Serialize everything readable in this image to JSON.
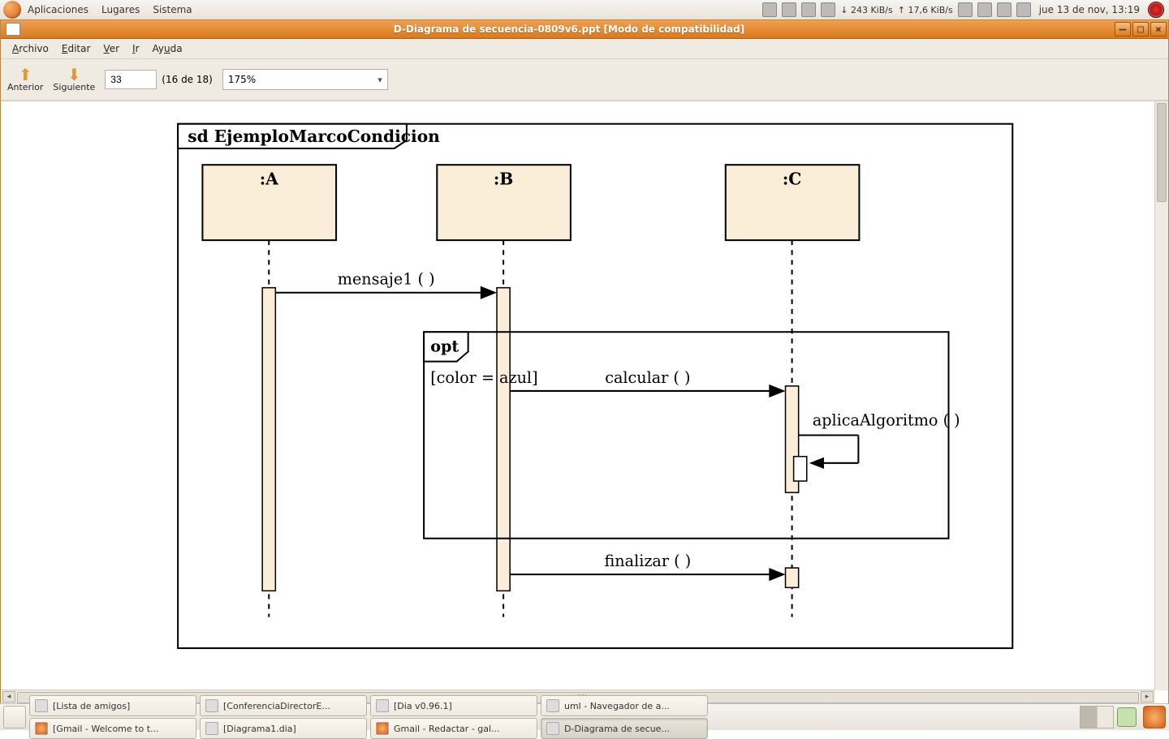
{
  "system": {
    "menus": {
      "apps": "Aplicaciones",
      "places": "Lugares",
      "system": "Sistema"
    },
    "net_down": "↓ 243 KiB/s",
    "net_up": "↑ 17,6 KiB/s",
    "clock": "jue 13 de nov, 13:19"
  },
  "window": {
    "title": "D-Diagrama de secuencia-0809v6.ppt [Modo de compatibilidad]"
  },
  "menubar": {
    "archivo": "Archivo",
    "editar": "Editar",
    "ver": "Ver",
    "ir": "Ir",
    "ayuda": "Ayuda"
  },
  "toolbar": {
    "prev": "Anterior",
    "next": "Siguiente",
    "page_value": "33",
    "page_of": "(16 de 18)",
    "zoom": "175%"
  },
  "diagram": {
    "frame_label": "sd EjemploMarcoCondicion",
    "lifelines": {
      "a": ":A",
      "b": ":B",
      "c": ":C"
    },
    "msg1": "mensaje1 ( )",
    "opt_label": "opt",
    "guard": "[color = azul]",
    "calcular": "calcular ( )",
    "self": "aplicaAlgoritmo ( )",
    "finalizar": "finalizar ( )"
  },
  "taskbar": {
    "t1": "[Lista de amigos]",
    "t2": "[Gmail - Welcome to t...",
    "t3": "[ConferenciaDirectorE...",
    "t4": "[Diagrama1.dia]",
    "t5": "[Dia v0.96.1]",
    "t6": "Gmail - Redactar - gal...",
    "t7": "uml - Navegador de a...",
    "t8": "D-Diagrama de secue..."
  }
}
